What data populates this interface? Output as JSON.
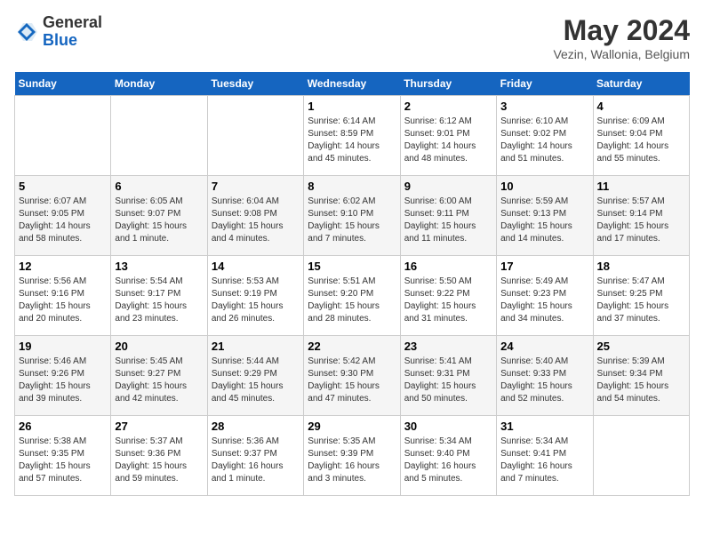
{
  "header": {
    "logo_general": "General",
    "logo_blue": "Blue",
    "month": "May 2024",
    "location": "Vezin, Wallonia, Belgium"
  },
  "weekdays": [
    "Sunday",
    "Monday",
    "Tuesday",
    "Wednesday",
    "Thursday",
    "Friday",
    "Saturday"
  ],
  "weeks": [
    [
      {
        "day": "",
        "info": ""
      },
      {
        "day": "",
        "info": ""
      },
      {
        "day": "",
        "info": ""
      },
      {
        "day": "1",
        "info": "Sunrise: 6:14 AM\nSunset: 8:59 PM\nDaylight: 14 hours and 45 minutes."
      },
      {
        "day": "2",
        "info": "Sunrise: 6:12 AM\nSunset: 9:01 PM\nDaylight: 14 hours and 48 minutes."
      },
      {
        "day": "3",
        "info": "Sunrise: 6:10 AM\nSunset: 9:02 PM\nDaylight: 14 hours and 51 minutes."
      },
      {
        "day": "4",
        "info": "Sunrise: 6:09 AM\nSunset: 9:04 PM\nDaylight: 14 hours and 55 minutes."
      }
    ],
    [
      {
        "day": "5",
        "info": "Sunrise: 6:07 AM\nSunset: 9:05 PM\nDaylight: 14 hours and 58 minutes."
      },
      {
        "day": "6",
        "info": "Sunrise: 6:05 AM\nSunset: 9:07 PM\nDaylight: 15 hours and 1 minute."
      },
      {
        "day": "7",
        "info": "Sunrise: 6:04 AM\nSunset: 9:08 PM\nDaylight: 15 hours and 4 minutes."
      },
      {
        "day": "8",
        "info": "Sunrise: 6:02 AM\nSunset: 9:10 PM\nDaylight: 15 hours and 7 minutes."
      },
      {
        "day": "9",
        "info": "Sunrise: 6:00 AM\nSunset: 9:11 PM\nDaylight: 15 hours and 11 minutes."
      },
      {
        "day": "10",
        "info": "Sunrise: 5:59 AM\nSunset: 9:13 PM\nDaylight: 15 hours and 14 minutes."
      },
      {
        "day": "11",
        "info": "Sunrise: 5:57 AM\nSunset: 9:14 PM\nDaylight: 15 hours and 17 minutes."
      }
    ],
    [
      {
        "day": "12",
        "info": "Sunrise: 5:56 AM\nSunset: 9:16 PM\nDaylight: 15 hours and 20 minutes."
      },
      {
        "day": "13",
        "info": "Sunrise: 5:54 AM\nSunset: 9:17 PM\nDaylight: 15 hours and 23 minutes."
      },
      {
        "day": "14",
        "info": "Sunrise: 5:53 AM\nSunset: 9:19 PM\nDaylight: 15 hours and 26 minutes."
      },
      {
        "day": "15",
        "info": "Sunrise: 5:51 AM\nSunset: 9:20 PM\nDaylight: 15 hours and 28 minutes."
      },
      {
        "day": "16",
        "info": "Sunrise: 5:50 AM\nSunset: 9:22 PM\nDaylight: 15 hours and 31 minutes."
      },
      {
        "day": "17",
        "info": "Sunrise: 5:49 AM\nSunset: 9:23 PM\nDaylight: 15 hours and 34 minutes."
      },
      {
        "day": "18",
        "info": "Sunrise: 5:47 AM\nSunset: 9:25 PM\nDaylight: 15 hours and 37 minutes."
      }
    ],
    [
      {
        "day": "19",
        "info": "Sunrise: 5:46 AM\nSunset: 9:26 PM\nDaylight: 15 hours and 39 minutes."
      },
      {
        "day": "20",
        "info": "Sunrise: 5:45 AM\nSunset: 9:27 PM\nDaylight: 15 hours and 42 minutes."
      },
      {
        "day": "21",
        "info": "Sunrise: 5:44 AM\nSunset: 9:29 PM\nDaylight: 15 hours and 45 minutes."
      },
      {
        "day": "22",
        "info": "Sunrise: 5:42 AM\nSunset: 9:30 PM\nDaylight: 15 hours and 47 minutes."
      },
      {
        "day": "23",
        "info": "Sunrise: 5:41 AM\nSunset: 9:31 PM\nDaylight: 15 hours and 50 minutes."
      },
      {
        "day": "24",
        "info": "Sunrise: 5:40 AM\nSunset: 9:33 PM\nDaylight: 15 hours and 52 minutes."
      },
      {
        "day": "25",
        "info": "Sunrise: 5:39 AM\nSunset: 9:34 PM\nDaylight: 15 hours and 54 minutes."
      }
    ],
    [
      {
        "day": "26",
        "info": "Sunrise: 5:38 AM\nSunset: 9:35 PM\nDaylight: 15 hours and 57 minutes."
      },
      {
        "day": "27",
        "info": "Sunrise: 5:37 AM\nSunset: 9:36 PM\nDaylight: 15 hours and 59 minutes."
      },
      {
        "day": "28",
        "info": "Sunrise: 5:36 AM\nSunset: 9:37 PM\nDaylight: 16 hours and 1 minute."
      },
      {
        "day": "29",
        "info": "Sunrise: 5:35 AM\nSunset: 9:39 PM\nDaylight: 16 hours and 3 minutes."
      },
      {
        "day": "30",
        "info": "Sunrise: 5:34 AM\nSunset: 9:40 PM\nDaylight: 16 hours and 5 minutes."
      },
      {
        "day": "31",
        "info": "Sunrise: 5:34 AM\nSunset: 9:41 PM\nDaylight: 16 hours and 7 minutes."
      },
      {
        "day": "",
        "info": ""
      }
    ]
  ]
}
